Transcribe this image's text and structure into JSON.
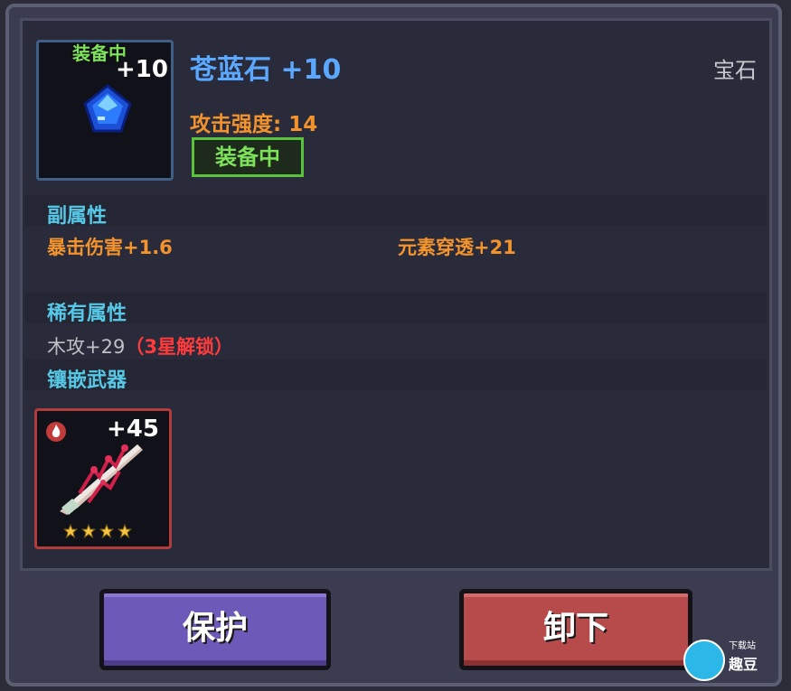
{
  "item": {
    "slot_tag": "装备中",
    "level": "+10",
    "name": "苍蓝石",
    "name_level": "+10",
    "category": "宝石",
    "main_stat": "攻击强度: 14",
    "equip_badge": "装备中"
  },
  "sections": {
    "secondary": {
      "label": "副属性",
      "stats": [
        "暴击伤害+1.6",
        "元素穿透+21"
      ]
    },
    "rare": {
      "label": "稀有属性",
      "stat": "木攻+29",
      "lock_note": "（3星解锁）"
    },
    "inlay": {
      "label": "镶嵌武器",
      "weapon_level": "+45",
      "weapon_stars": 4
    }
  },
  "buttons": {
    "protect": "保护",
    "unequip": "卸下"
  },
  "watermark": {
    "text": "趣豆",
    "small": "下载站"
  },
  "colors": {
    "name": "#5aa8ff",
    "stat_orange": "#f3932c",
    "section_cyan": "#56c8e6",
    "equip_green": "#7ee15a",
    "lock_red": "#ff3b3b"
  }
}
